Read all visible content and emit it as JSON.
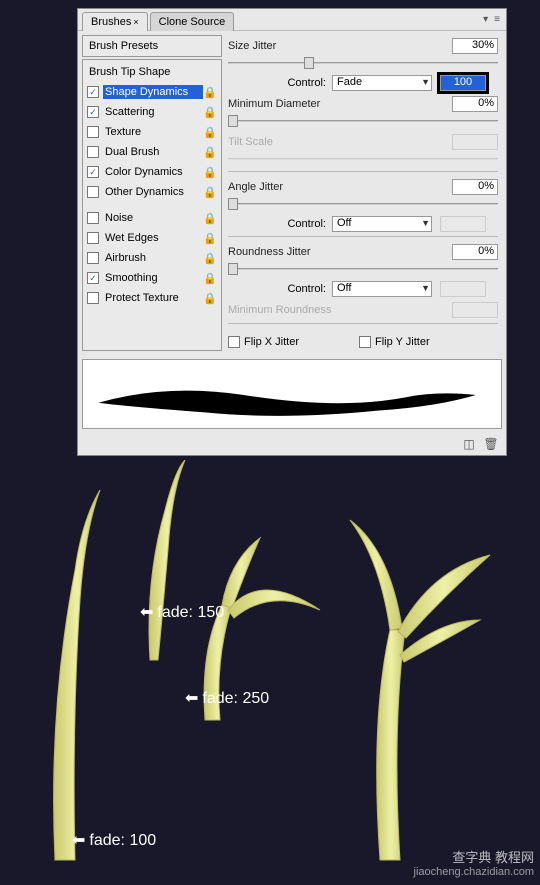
{
  "tabs": {
    "brushes": "Brushes",
    "clone": "Clone Source"
  },
  "sidebar": {
    "presets_header": "Brush Presets",
    "items": [
      {
        "label": "Brush Tip Shape",
        "hasCheckbox": false,
        "checked": false,
        "selected": false
      },
      {
        "label": "Shape Dynamics",
        "hasCheckbox": true,
        "checked": true,
        "selected": true
      },
      {
        "label": "Scattering",
        "hasCheckbox": true,
        "checked": true,
        "selected": false
      },
      {
        "label": "Texture",
        "hasCheckbox": true,
        "checked": false,
        "selected": false
      },
      {
        "label": "Dual Brush",
        "hasCheckbox": true,
        "checked": false,
        "selected": false
      },
      {
        "label": "Color Dynamics",
        "hasCheckbox": true,
        "checked": true,
        "selected": false
      },
      {
        "label": "Other Dynamics",
        "hasCheckbox": true,
        "checked": false,
        "selected": false
      },
      {
        "label": "Noise",
        "hasCheckbox": true,
        "checked": false,
        "selected": false
      },
      {
        "label": "Wet Edges",
        "hasCheckbox": true,
        "checked": false,
        "selected": false
      },
      {
        "label": "Airbrush",
        "hasCheckbox": true,
        "checked": false,
        "selected": false
      },
      {
        "label": "Smoothing",
        "hasCheckbox": true,
        "checked": true,
        "selected": false
      },
      {
        "label": "Protect Texture",
        "hasCheckbox": true,
        "checked": false,
        "selected": false
      }
    ]
  },
  "controls": {
    "size_jitter": {
      "label": "Size Jitter",
      "value": "30%"
    },
    "size_control": {
      "label": "Control:",
      "selected": "Fade",
      "input": "100"
    },
    "min_diameter": {
      "label": "Minimum Diameter",
      "value": "0%"
    },
    "tilt_scale": {
      "label": "Tilt Scale",
      "value": ""
    },
    "angle_jitter": {
      "label": "Angle Jitter",
      "value": "0%"
    },
    "angle_control": {
      "label": "Control:",
      "selected": "Off"
    },
    "roundness_jitter": {
      "label": "Roundness Jitter",
      "value": "0%"
    },
    "roundness_control": {
      "label": "Control:",
      "selected": "Off"
    },
    "min_roundness": {
      "label": "Minimum Roundness",
      "value": ""
    },
    "flip_x": "Flip X Jitter",
    "flip_y": "Flip Y Jitter"
  },
  "annotations": {
    "a150": "fade: 150",
    "a250": "fade: 250",
    "a100": "fade: 100"
  },
  "watermark": {
    "main": "查字典 教程网",
    "site": "jiaocheng.chazidian.com"
  },
  "colors": {
    "branch": "#e5e58a",
    "branch_dark": "#c9c96e",
    "select": "#2461d6"
  }
}
